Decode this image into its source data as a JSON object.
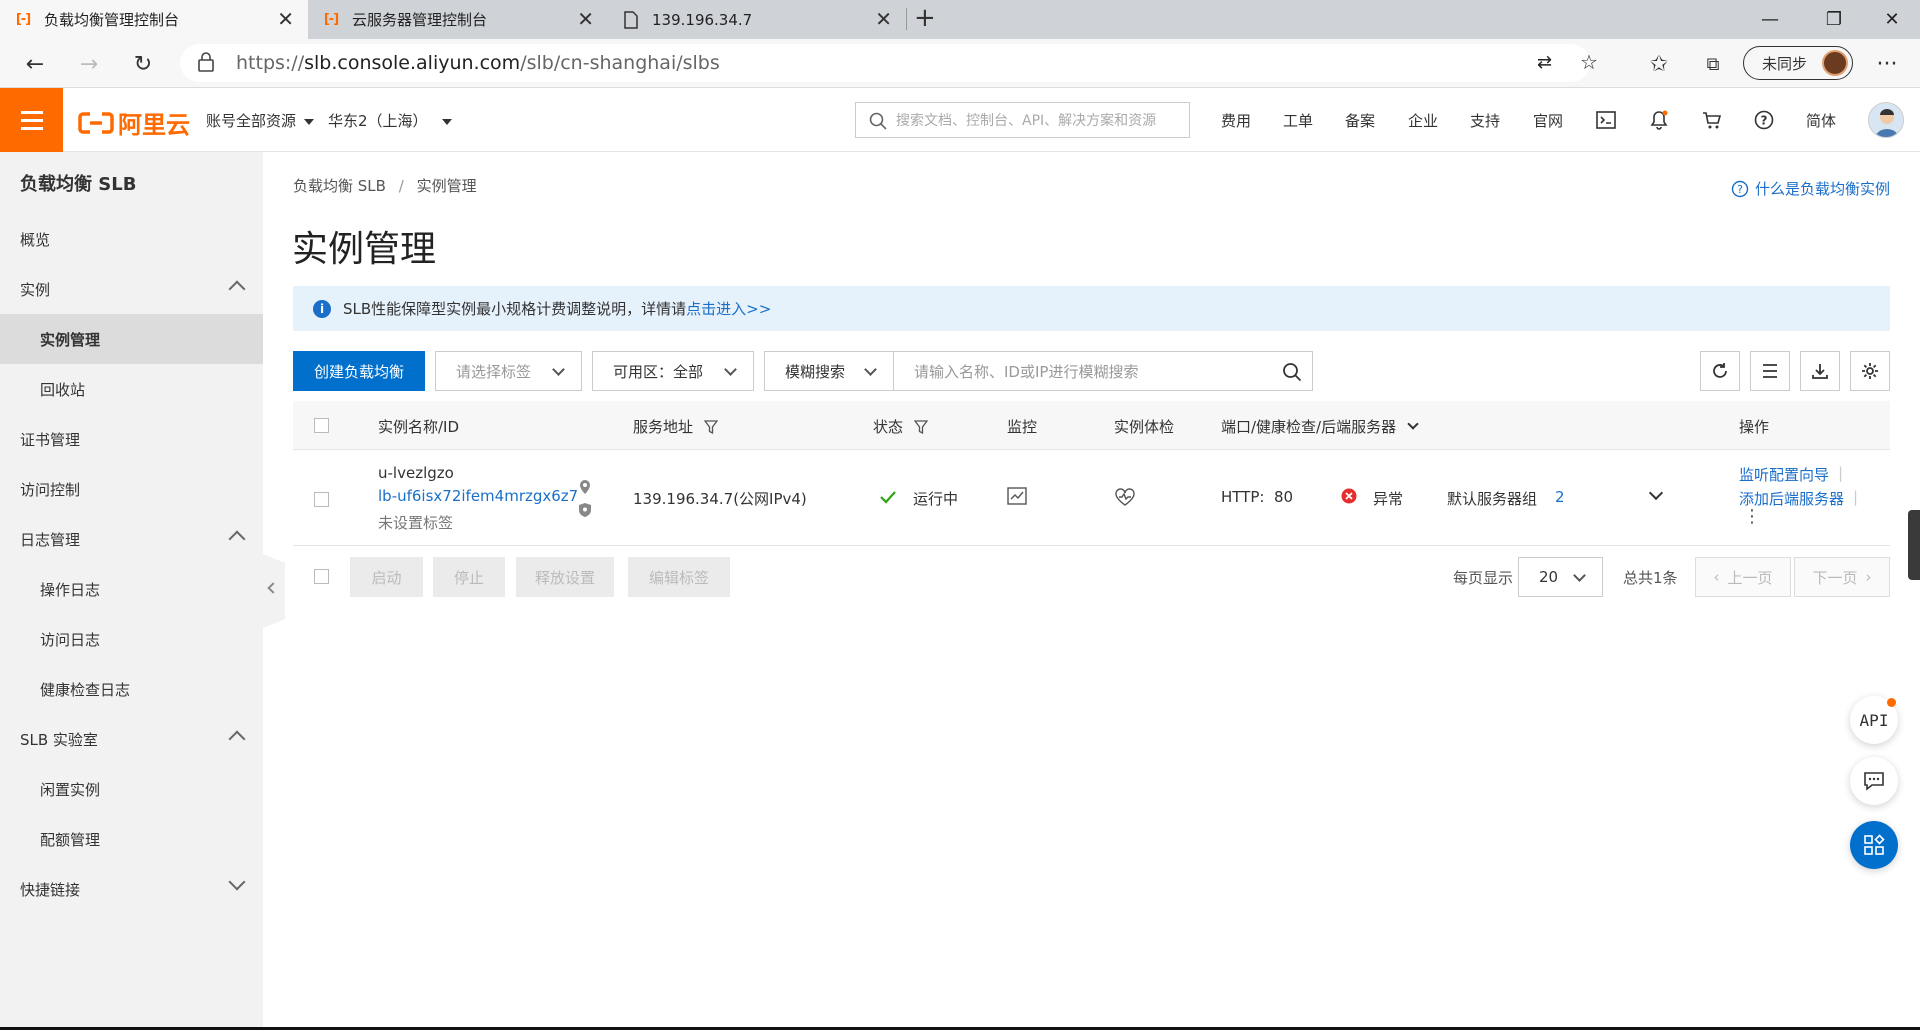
{
  "browser": {
    "tabs": [
      {
        "title": "负载均衡管理控制台",
        "active": true
      },
      {
        "title": "云服务器管理控制台",
        "active": false
      },
      {
        "title": "139.196.34.7",
        "active": false
      }
    ],
    "url_prefix": "https://",
    "url_host": "slb.console.aliyun.com",
    "url_path": "/slb/cn-shanghai/slbs",
    "sync_label": "未同步"
  },
  "topbar": {
    "brand": "阿里云",
    "account_scope": "账号全部资源",
    "region": "华东2（上海）",
    "search_placeholder": "搜索文档、控制台、API、解决方案和资源",
    "links": [
      "费用",
      "工单",
      "备案",
      "企业",
      "支持",
      "官网"
    ],
    "lang": "简体"
  },
  "sidebar": {
    "title": "负载均衡 SLB",
    "items": [
      {
        "label": "概览"
      },
      {
        "label": "实例"
      },
      {
        "label": "实例管理"
      },
      {
        "label": "回收站"
      },
      {
        "label": "证书管理"
      },
      {
        "label": "访问控制"
      },
      {
        "label": "日志管理"
      },
      {
        "label": "操作日志"
      },
      {
        "label": "访问日志"
      },
      {
        "label": "健康检查日志"
      },
      {
        "label": "SLB 实验室"
      },
      {
        "label": "闲置实例"
      },
      {
        "label": "配额管理"
      },
      {
        "label": "快捷链接"
      }
    ]
  },
  "main": {
    "breadcrumb_root": "负载均衡 SLB",
    "breadcrumb_sep": "/",
    "breadcrumb_current": "实例管理",
    "help_link": "什么是负载均衡实例",
    "title": "实例管理",
    "notice_text": "SLB性能保障型实例最小规格计费调整说明，详情请",
    "notice_link": "点击进入>>",
    "create_button": "创建负载均衡",
    "tag_select_placeholder": "请选择标签",
    "zone_label": "可用区：全部",
    "search_mode": "模糊搜索",
    "search_placeholder": "请输入名称、ID或IP进行模糊搜索"
  },
  "table": {
    "headers": [
      "实例名称/ID",
      "服务地址",
      "状态",
      "监控",
      "实例体检",
      "端口/健康检查/后端服务器",
      "操作"
    ],
    "rows": [
      {
        "name": "u-lvezlgzo",
        "id": "lb-uf6isx72ifem4mrzgx6z7",
        "tag": "未设置标签",
        "address": "139.196.34.7(公网IPv4)",
        "status": "运行中",
        "protocol": "HTTP:",
        "port": "80",
        "health": "异常",
        "server_group": "默认服务器组",
        "server_count": "2",
        "action_1": "监听配置向导",
        "action_2": "添加后端服务器"
      }
    ]
  },
  "batch": {
    "start": "启动",
    "stop": "停止",
    "release": "释放设置",
    "edit_tags": "编辑标签"
  },
  "pagination": {
    "per_page_label": "每页显示",
    "per_page": "20",
    "total": "总共1条",
    "prev": "上一页",
    "next": "下一页"
  },
  "floating": {
    "api_label": "API"
  },
  "colors": {
    "brand_orange": "#ff6a00",
    "primary_blue": "#0070cc",
    "link_blue": "#1a6fc9",
    "success_green": "#2aa515",
    "error_red": "#e62c2c"
  }
}
